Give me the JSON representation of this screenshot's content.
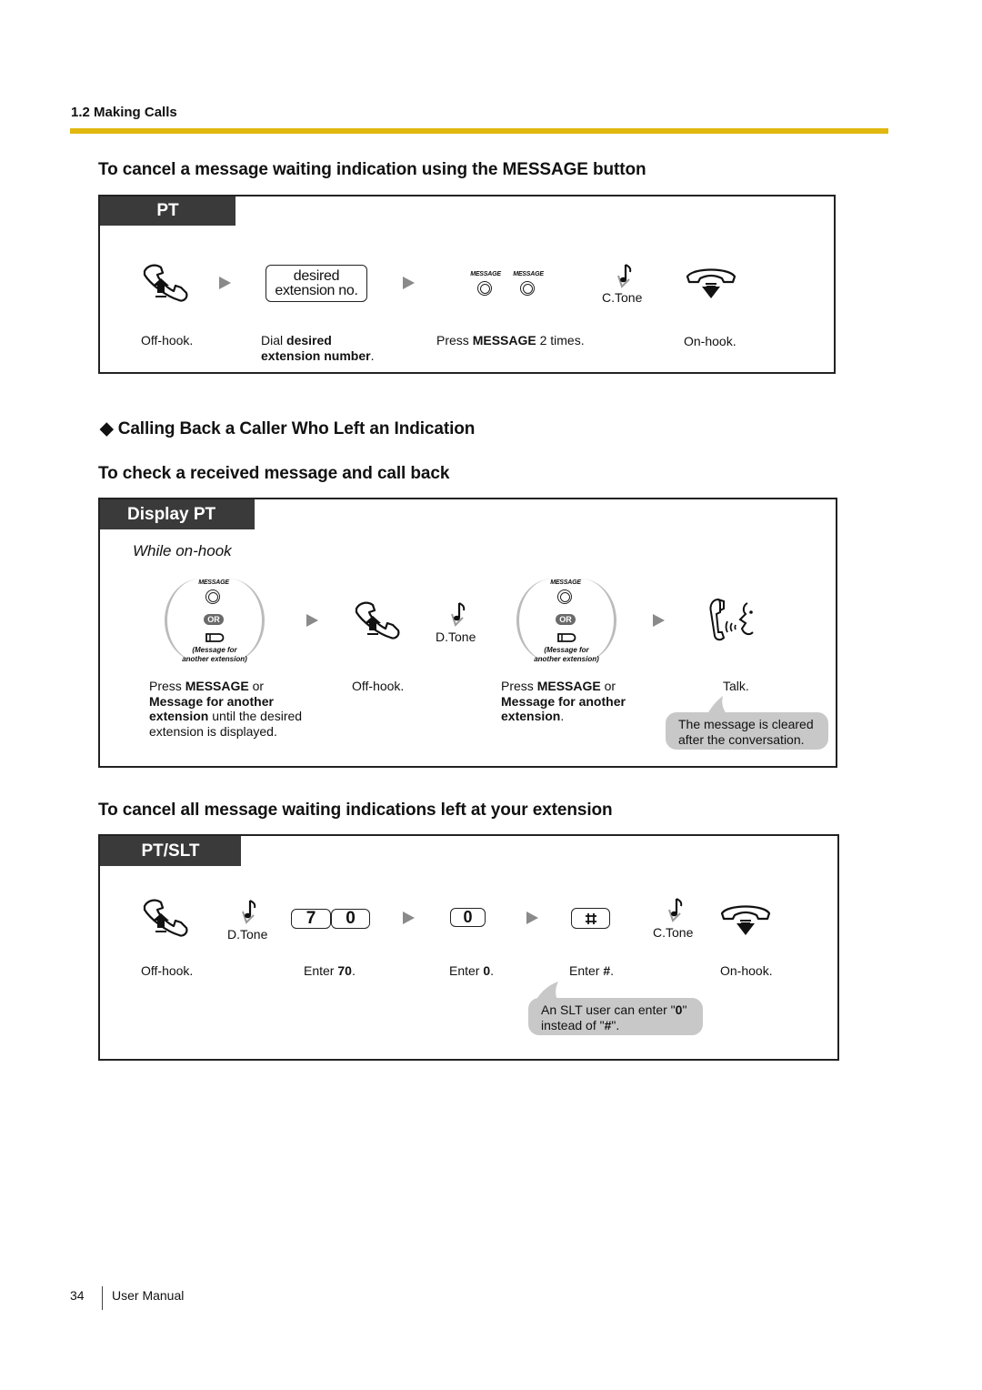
{
  "header": {
    "section": "1.2 Making Calls",
    "rule_color": "#e0b810"
  },
  "section1": {
    "title": "To cancel a message waiting indication using the MESSAGE button",
    "tab": "PT",
    "steps": [
      {
        "icon": "off-hook-icon",
        "desc": "Off-hook."
      },
      {
        "icon": "desired-extension-key",
        "key_line1": "desired",
        "key_line2": "extension no.",
        "desc_pre": "Dial ",
        "desc_bold": "desired",
        "desc_bold2": "extension number",
        "desc_post": "."
      },
      {
        "icon": "message-button-icon",
        "caption": "MESSAGE",
        "desc_pre": "Press ",
        "desc_bold": "MESSAGE",
        "desc_post": " 2 times."
      },
      {
        "icon": "tone-icon",
        "label": "C.Tone"
      },
      {
        "icon": "on-hook-icon",
        "desc": "On-hook."
      }
    ]
  },
  "section2": {
    "heading": "Calling Back a Caller Who Left an Indication",
    "heading_bullet": "◆",
    "title": "To check a received message and call back",
    "tab": "Display PT",
    "condition": "While on-hook",
    "steps": [
      {
        "caption": "MESSAGE",
        "or": "OR",
        "note_line1": "(Message for",
        "note_line2": "another extension)",
        "desc_pre": "Press ",
        "desc_bold": "MESSAGE",
        "desc_mid": " or",
        "desc_bold2": "Message for another",
        "desc_bold3": "extension",
        "desc_post": " until the desired",
        "desc_line4": "extension is displayed."
      },
      {
        "desc": "Off-hook."
      },
      {
        "label": "D.Tone"
      },
      {
        "caption": "MESSAGE",
        "or": "OR",
        "note_line1": "(Message for",
        "note_line2": "another extension)",
        "desc_pre": "Press ",
        "desc_bold": "MESSAGE",
        "desc_mid": " or",
        "desc_bold2": "Message for another",
        "desc_bold3": "extension",
        "desc_post": "."
      },
      {
        "desc": "Talk."
      }
    ],
    "note": {
      "line1": "The message is cleared",
      "line2": "after the conversation."
    }
  },
  "section3": {
    "title": "To cancel all message waiting indications left at your extension",
    "tab": "PT/SLT",
    "steps": [
      {
        "desc": "Off-hook."
      },
      {
        "label": "D.Tone"
      },
      {
        "keys": [
          "7",
          "0"
        ],
        "desc_pre": "Enter ",
        "desc_bold": "70",
        "desc_post": "."
      },
      {
        "keys": [
          "0"
        ],
        "desc_pre": "Enter ",
        "desc_bold": "0",
        "desc_post": "."
      },
      {
        "keys": [
          "#"
        ],
        "desc_pre": "Enter ",
        "desc_bold": "#",
        "desc_post": "."
      },
      {
        "label": "C.Tone"
      },
      {
        "desc": "On-hook."
      }
    ],
    "note": {
      "pre": "An SLT user can enter \"",
      "bold1": "0",
      "mid": "\"",
      "line2_pre": "instead of \"",
      "bold2": "#",
      "line2_post": "\"."
    }
  },
  "footer": {
    "page_number": "34",
    "manual": "User Manual"
  }
}
